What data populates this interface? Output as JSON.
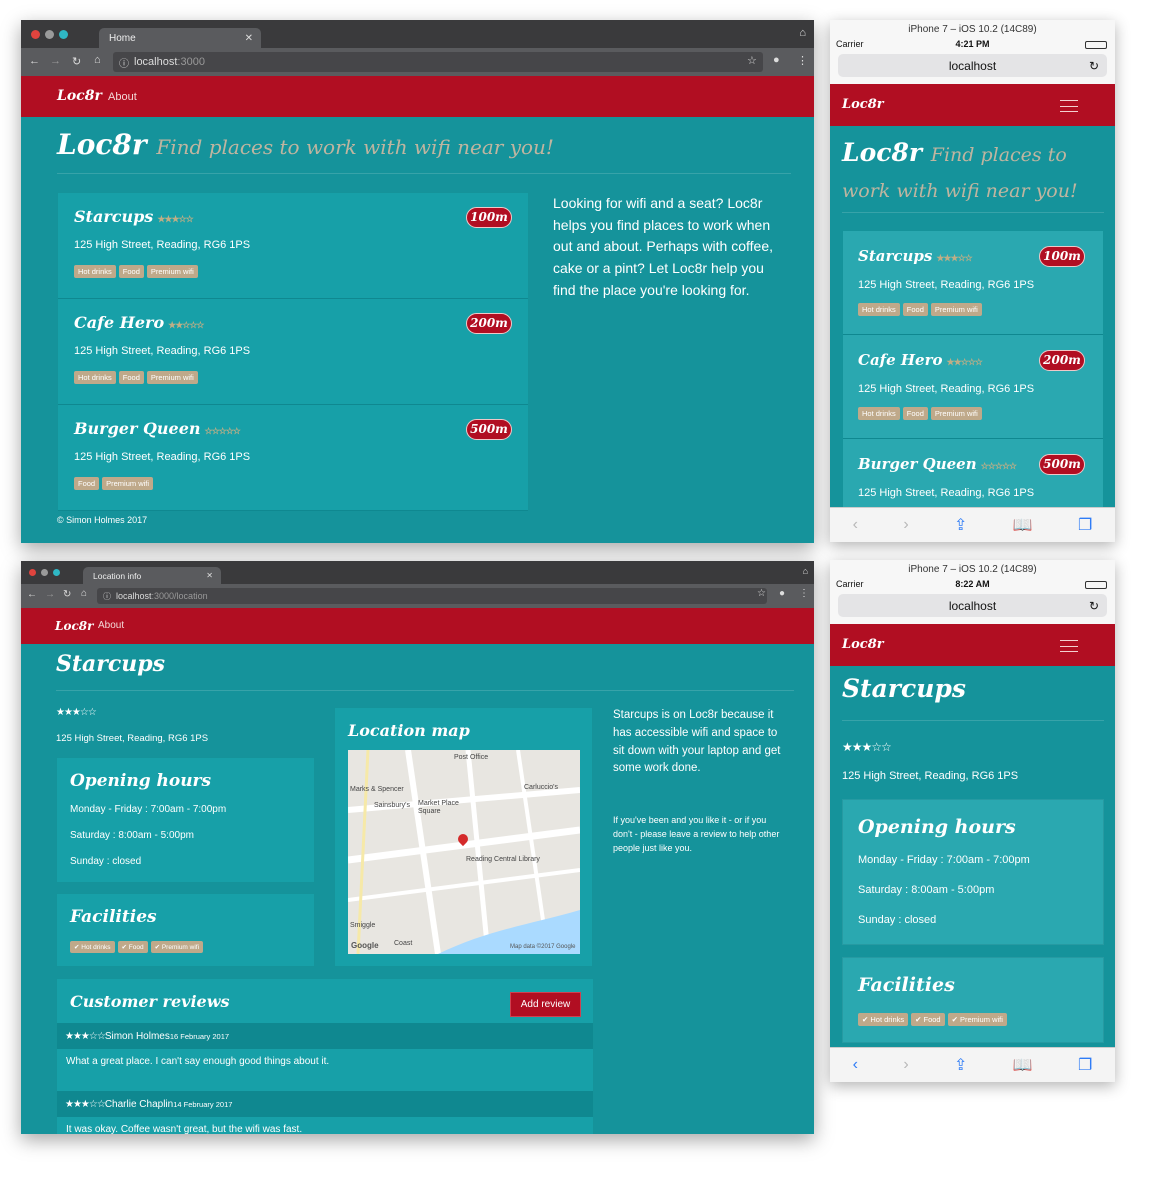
{
  "home_browser": {
    "tab_title": "Home",
    "url_host": "localhost",
    "url_rest": ":3000",
    "brand": "Loc8r",
    "nav_about": "About",
    "heading": "Loc8r",
    "heading_sub": "Find places to work with wifi near you!",
    "locations": [
      {
        "name": "Starcups",
        "stars": "★★★☆☆",
        "address": "125 High Street, Reading, RG6 1PS",
        "distance": "100m",
        "facilities": [
          "Hot drinks",
          "Food",
          "Premium wifi"
        ]
      },
      {
        "name": "Cafe Hero",
        "stars": "★★☆☆☆",
        "address": "125 High Street, Reading, RG6 1PS",
        "distance": "200m",
        "facilities": [
          "Hot drinks",
          "Food",
          "Premium wifi"
        ]
      },
      {
        "name": "Burger Queen",
        "stars": "☆☆☆☆☆",
        "address": "125 High Street, Reading, RG6 1PS",
        "distance": "500m",
        "facilities": [
          "Food",
          "Premium wifi"
        ]
      }
    ],
    "sidebar": "Looking for wifi and a seat? Loc8r helps you find places to work when out and about. Perhaps with coffee, cake or a pint? Let Loc8r help you find the place you're looking for.",
    "footer": "© Simon Holmes 2017"
  },
  "home_phone": {
    "device_title": "iPhone 7 – iOS 10.2 (14C89)",
    "carrier": "Carrier",
    "time": "4:21 PM",
    "url": "localhost",
    "brand": "Loc8r",
    "heading": "Loc8r",
    "heading_sub": "Find places to work with wifi near you!"
  },
  "loc_browser": {
    "tab_title": "Location info",
    "url_host": "localhost",
    "url_rest": ":3000/location",
    "brand": "Loc8r",
    "nav_about": "About",
    "name": "Starcups",
    "stars": "★★★☆☆",
    "address": "125 High Street, Reading, RG6 1PS",
    "opening_title": "Opening hours",
    "hours": [
      "Monday - Friday : 7:00am - 7:00pm",
      "Saturday : 8:00am - 5:00pm",
      "Sunday : closed"
    ],
    "facilities_title": "Facilities",
    "facilities": [
      "✔ Hot drinks",
      "✔ Food",
      "✔ Premium wifi"
    ],
    "map_title": "Location map",
    "map_labels": {
      "post_office": "Post Office",
      "marks": "Marks & Spencer",
      "sainsburys": "Sainsbury's",
      "market": "Market Place Square",
      "carluccios": "Carluccio's",
      "library": "Reading Central Library",
      "smiggle": "Smiggle",
      "coast": "Coast",
      "google": "Google",
      "mapdata": "Map data ©2017 Google"
    },
    "side_p1": "Starcups is on Loc8r because it has accessible wifi and space to sit down with your laptop and get some work done.",
    "side_p2": "If you've been and you like it - or if you don't - please leave a review to help other people just like you.",
    "reviews_title": "Customer reviews",
    "add_review": "Add review",
    "reviews": [
      {
        "stars": "★★★☆☆",
        "author": "Simon Holmes",
        "date": "16 February 2017",
        "text": "What a great place. I can't say enough good things about it."
      },
      {
        "stars": "★★★☆☆",
        "author": "Charlie Chaplin",
        "date": "14 February 2017",
        "text": "It was okay. Coffee wasn't great, but the wifi was fast."
      }
    ]
  },
  "loc_phone": {
    "device_title": "iPhone 7 – iOS 10.2 (14C89)",
    "carrier": "Carrier",
    "time": "8:22 AM",
    "url": "localhost",
    "brand": "Loc8r",
    "name": "Starcups",
    "stars": "★★★☆☆",
    "address": "125 High Street, Reading, RG6 1PS",
    "opening_title": "Opening hours",
    "hours": [
      "Monday - Friday : 7:00am - 7:00pm",
      "Saturday : 8:00am - 5:00pm",
      "Sunday : closed"
    ],
    "facilities_title": "Facilities",
    "facilities": [
      "✔ Hot drinks",
      "✔ Food",
      "✔ Premium wifi"
    ]
  },
  "colors": {
    "teal": "#15939b",
    "panel": "#17a0a8",
    "red": "#b10e22",
    "tag": "#bfa98a",
    "sub": "#bfb5a0"
  }
}
